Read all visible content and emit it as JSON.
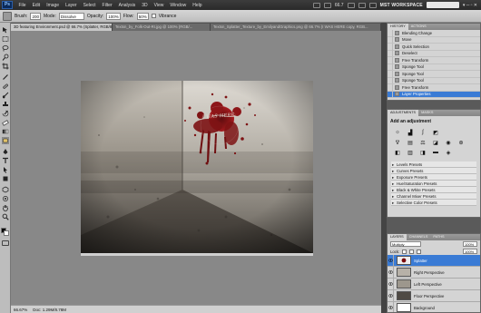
{
  "app": {
    "logo": "Ps"
  },
  "menubar": {
    "items": [
      "File",
      "Edit",
      "Image",
      "Layer",
      "Select",
      "Filter",
      "Analysis",
      "3D",
      "View",
      "Window",
      "Help"
    ],
    "zoom": "66.7",
    "workspace": "MST WORKSPACE",
    "window_buttons": "▾ ─ ▫ ✕"
  },
  "options": {
    "brush_label": "Brush:",
    "brush_size": "200",
    "mode_label": "Mode:",
    "mode_value": "Dissolve",
    "opacity_label": "Opacity:",
    "opacity_value": "100%",
    "flow_label": "Flow:",
    "flow_value": "50%",
    "airbrush_label": "Vibrance"
  },
  "tabs": [
    {
      "label": "3D featuring Environment.psd @ 66.7% (Splatter, RGB/8) *"
    },
    {
      "label": "Textsn_by_Folk-Out-RI.jpg @ 100% (RGB/..."
    },
    {
      "label": "Textsn_Splatter_Texture_by_EmilyandGraphics.png @ 66.7% (I WAS HERE copy, RGB..."
    }
  ],
  "document": {
    "graffiti_text": "I WAS HERE"
  },
  "status": {
    "zoom": "66.67%",
    "doc_size": "Doc: 1.29M/8.78M"
  },
  "history": {
    "tabs": [
      "History",
      "Actions"
    ],
    "items": [
      {
        "label": "Blending Change"
      },
      {
        "label": "Move"
      },
      {
        "label": "Quick Selection"
      },
      {
        "label": "Deselect"
      },
      {
        "label": "Free Transform"
      },
      {
        "label": "Sponge Tool"
      },
      {
        "label": "Sponge Tool"
      },
      {
        "label": "Sponge Tool"
      },
      {
        "label": "Free Transform"
      },
      {
        "label": "Layer Properties"
      }
    ]
  },
  "adjustments": {
    "tabs": [
      "Adjustments",
      "Masks"
    ],
    "title": "Add an adjustment",
    "presets": [
      "Levels Presets",
      "Curves Presets",
      "Exposure Presets",
      "Hue/Saturation Presets",
      "Black & White Presets",
      "Channel Mixer Presets",
      "Selective Color Presets"
    ]
  },
  "layers": {
    "tabs": [
      "Layers",
      "Channels",
      "Paths"
    ],
    "blend_mode": "Multiply",
    "opacity": "100%",
    "lock_label": "Lock:",
    "fill": "100%",
    "items": [
      {
        "name": "Splatter"
      },
      {
        "name": "Right Perspective"
      },
      {
        "name": "Left Perspective"
      },
      {
        "name": "Floor Perspective"
      },
      {
        "name": "Background"
      }
    ]
  },
  "colors": {
    "accent": "#3a7bd5",
    "blood": "#7a0a0c"
  }
}
